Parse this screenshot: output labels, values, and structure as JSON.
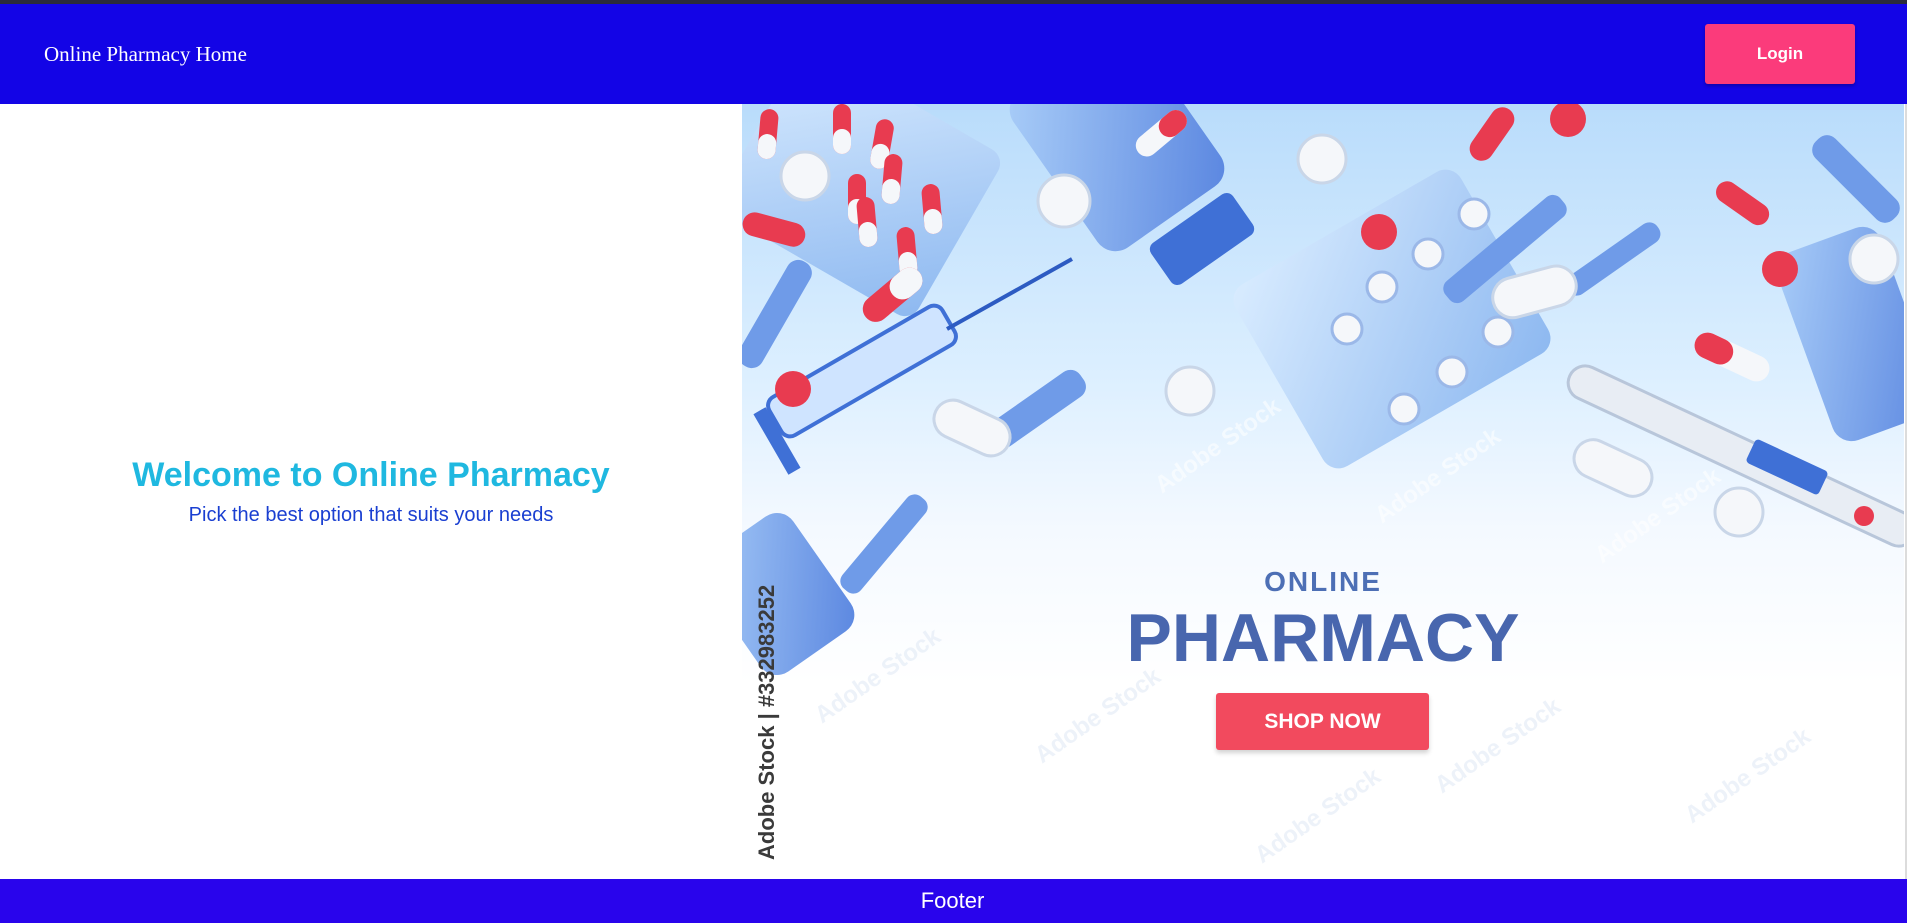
{
  "header": {
    "title": "Online Pharmacy Home",
    "login_label": "Login"
  },
  "welcome": {
    "title": "Welcome to Online Pharmacy",
    "subtitle": "Pick the best option that suits your needs"
  },
  "hero": {
    "line1": "ONLINE",
    "line2": "PHARMACY",
    "cta_label": "SHOP NOW",
    "stock_credit": "Adobe Stock | #332983252",
    "watermark": "Adobe Stock"
  },
  "footer": {
    "label": "Footer"
  },
  "colors": {
    "header_bg": "#1304e6",
    "login_button": "#fb3b7b",
    "welcome_title": "#1fb8e0",
    "welcome_subtitle": "#1a3fd1",
    "footer_bg": "#2904ec"
  }
}
